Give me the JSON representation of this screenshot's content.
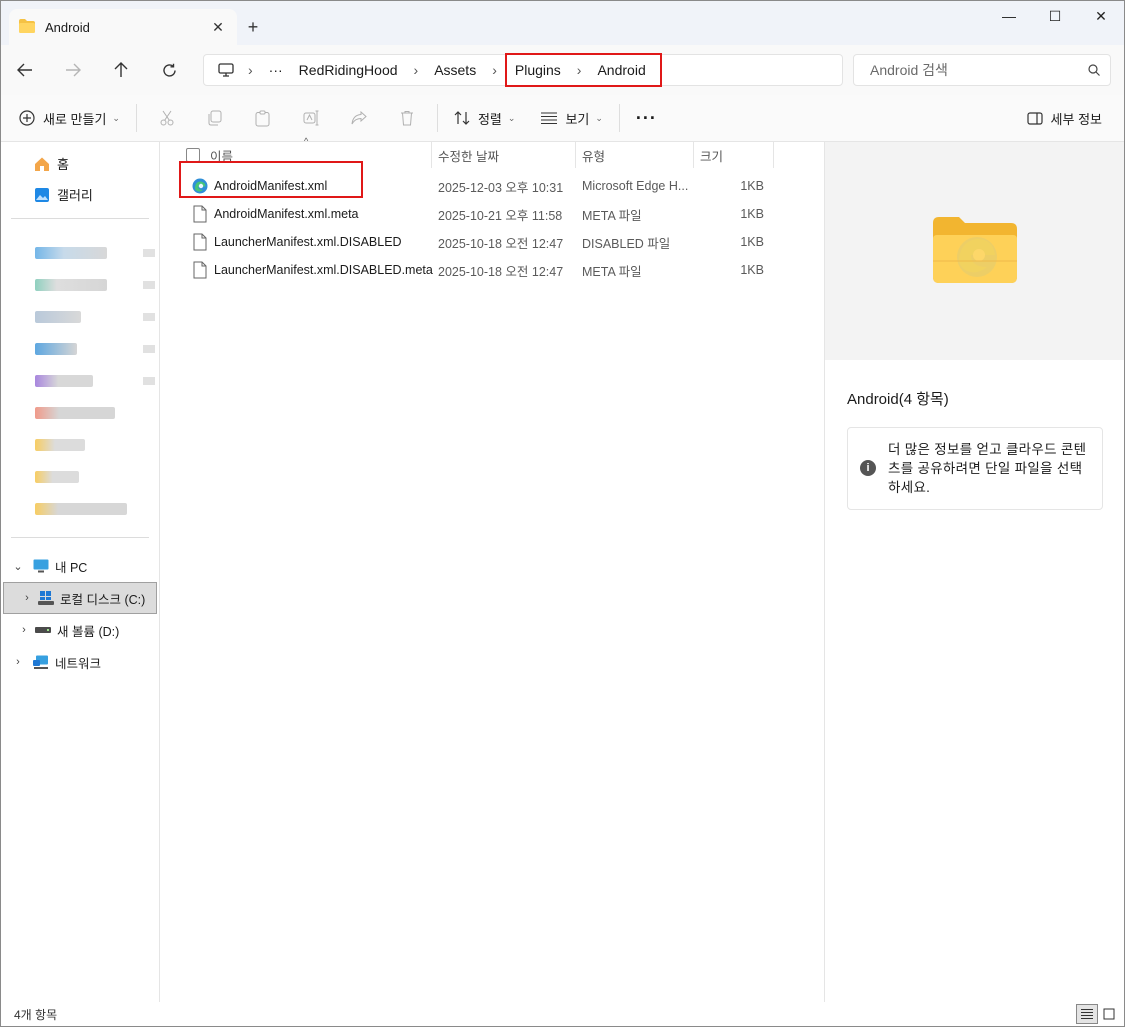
{
  "tab": {
    "title": "Android",
    "close": "✕",
    "new_tab": "+"
  },
  "window_controls": {
    "minimize": "—",
    "maximize": "☐",
    "close": "✕"
  },
  "address": {
    "more": "···",
    "crumbs": [
      "RedRidingHood",
      "Assets",
      "Plugins",
      "Android"
    ],
    "search_placeholder": "Android 검색"
  },
  "commandbar": {
    "new_label": "새로 만들기",
    "sort_label": "정렬",
    "view_label": "보기",
    "more": "···",
    "details_label": "세부 정보"
  },
  "nav": {
    "home": "홈",
    "gallery": "갤러리",
    "this_pc": "내 PC",
    "drive_c": "로컬 디스크 (C:)",
    "drive_d": "새 볼륨 (D:)",
    "network": "네트워크"
  },
  "columns": {
    "name": "이름",
    "date": "수정한 날짜",
    "type": "유형",
    "size": "크기"
  },
  "files": [
    {
      "name": "AndroidManifest.xml",
      "date": "2025-12-03 오후 10:31",
      "type": "Microsoft Edge H...",
      "size": "1KB",
      "icon": "edge-icon"
    },
    {
      "name": "AndroidManifest.xml.meta",
      "date": "2025-10-21 오후 11:58",
      "type": "META 파일",
      "size": "1KB",
      "icon": "file-icon"
    },
    {
      "name": "LauncherManifest.xml.DISABLED",
      "date": "2025-10-18 오전 12:47",
      "type": "DISABLED 파일",
      "size": "1KB",
      "icon": "file-icon"
    },
    {
      "name": "LauncherManifest.xml.DISABLED.meta",
      "date": "2025-10-18 오전 12:47",
      "type": "META 파일",
      "size": "1KB",
      "icon": "file-icon"
    }
  ],
  "details": {
    "title": "Android(4 항목)",
    "info_text": "더 많은 정보를 얻고 클라우드 콘텐츠를 공유하려면 단일 파일을 선택하세요."
  },
  "status": {
    "count": "4개 항목"
  },
  "colors": {
    "highlight_red": "#e01818",
    "folder_yellow": "#f5c244",
    "accent_blue": "#0078d4"
  }
}
